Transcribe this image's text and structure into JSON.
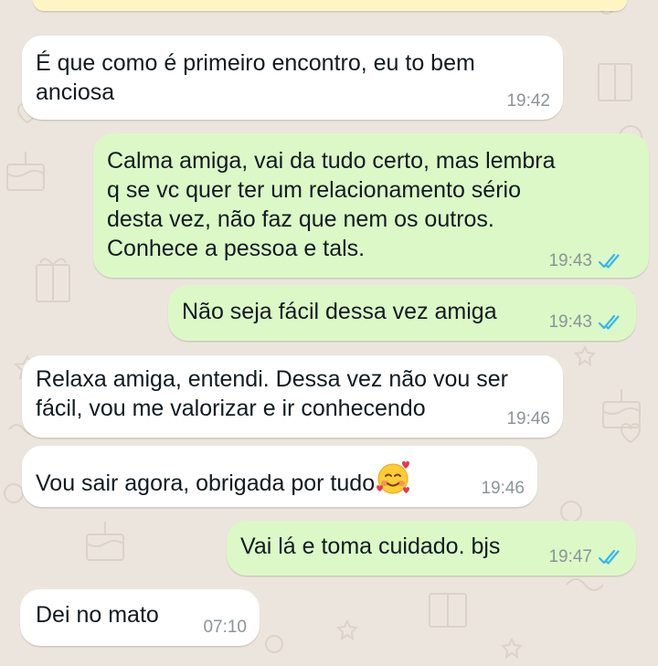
{
  "colors": {
    "wallpaper": "#ECE5DD",
    "incoming_bubble": "#FFFFFF",
    "outgoing_bubble": "#DCF8C6",
    "read_ticks": "#34B7F1",
    "timestamp": "#8A9499"
  },
  "messages": [
    {
      "direction": "in",
      "text": "É que como é primeiro encontro, eu to bem\nanciosa",
      "time": "19:42"
    },
    {
      "direction": "out",
      "text": "Calma amiga, vai da tudo certo, mas lembra\nq se vc quer ter um relacionamento sério\ndesta vez, não faz que nem os outros.\nConhece a pessoa e tals.",
      "time": "19:43",
      "status": "read"
    },
    {
      "direction": "out",
      "text": "Não seja fácil dessa vez amiga",
      "time": "19:43",
      "status": "read"
    },
    {
      "direction": "in",
      "text": "Relaxa amiga, entendi. Dessa vez não vou ser\nfácil, vou me valorizar e ir conhecendo",
      "time": "19:46"
    },
    {
      "direction": "in",
      "text": "Vou sair agora, obrigada por tudo",
      "emoji": "smiling-face-with-hearts-icon",
      "time": "19:46"
    },
    {
      "direction": "out",
      "text": "Vai lá e toma cuidado. bjs",
      "time": "19:47",
      "status": "read"
    },
    {
      "direction": "in",
      "text": "Dei no mato",
      "time": "07:10"
    }
  ]
}
